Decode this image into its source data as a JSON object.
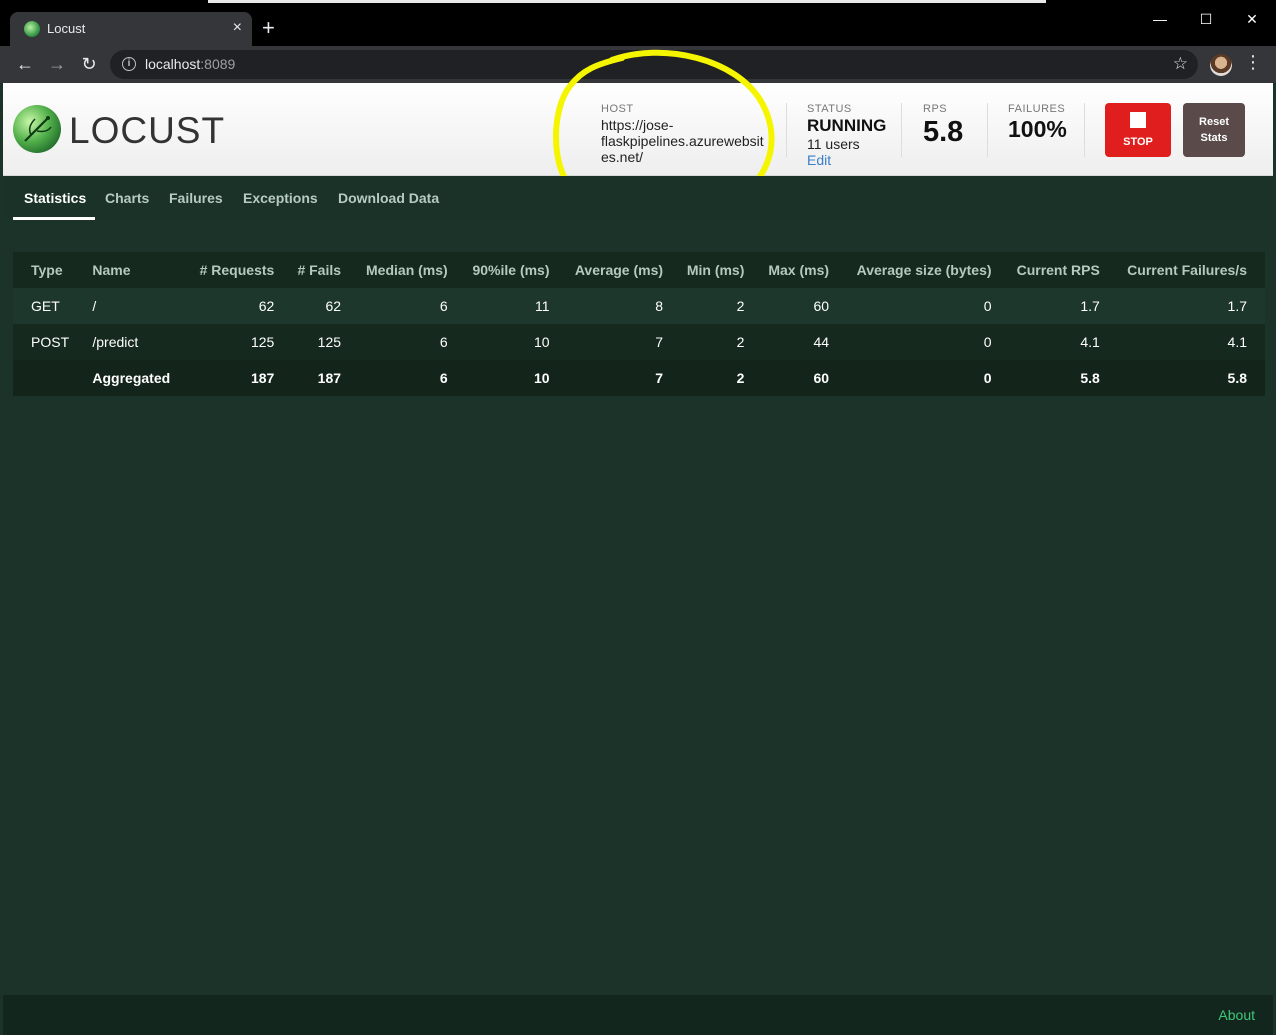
{
  "browser": {
    "tab_title": "Locust",
    "tab_close": "×",
    "new_tab": "+",
    "url_host": "localhost",
    "url_port": ":8089"
  },
  "header": {
    "logo_text": "LOCUST",
    "host_label": "HOST",
    "host_value": "https://jose-flaskpipelines.azurewebsites.net/",
    "status_label": "STATUS",
    "status_value": "RUNNING",
    "users": "11 users",
    "edit": "Edit",
    "rps_label": "RPS",
    "rps_value": "5.8",
    "failures_label": "FAILURES",
    "failures_value": "100%",
    "stop_label": "STOP",
    "reset_label_1": "Reset",
    "reset_label_2": "Stats",
    "highlight_color": "#f5f500"
  },
  "tabs": [
    {
      "label": "Statistics"
    },
    {
      "label": "Charts"
    },
    {
      "label": "Failures"
    },
    {
      "label": "Exceptions"
    },
    {
      "label": "Download Data"
    }
  ],
  "table": {
    "columns": [
      "Type",
      "Name",
      "# Requests",
      "# Fails",
      "Median (ms)",
      "90%ile (ms)",
      "Average (ms)",
      "Min (ms)",
      "Max (ms)",
      "Average size (bytes)",
      "Current RPS",
      "Current Failures/s"
    ],
    "rows": [
      {
        "type": "GET",
        "name": "/",
        "requests": "62",
        "fails": "62",
        "median": "6",
        "p90": "11",
        "average": "8",
        "min": "2",
        "max": "60",
        "avg_size": "0",
        "rps": "1.7",
        "fails_s": "1.7"
      },
      {
        "type": "POST",
        "name": "/predict",
        "requests": "125",
        "fails": "125",
        "median": "6",
        "p90": "10",
        "average": "7",
        "min": "2",
        "max": "44",
        "avg_size": "0",
        "rps": "4.1",
        "fails_s": "4.1"
      }
    ],
    "total": {
      "type": "",
      "name": "Aggregated",
      "requests": "187",
      "fails": "187",
      "median": "6",
      "p90": "10",
      "average": "7",
      "min": "2",
      "max": "60",
      "avg_size": "0",
      "rps": "5.8",
      "fails_s": "5.8"
    }
  },
  "footer": {
    "about": "About"
  }
}
